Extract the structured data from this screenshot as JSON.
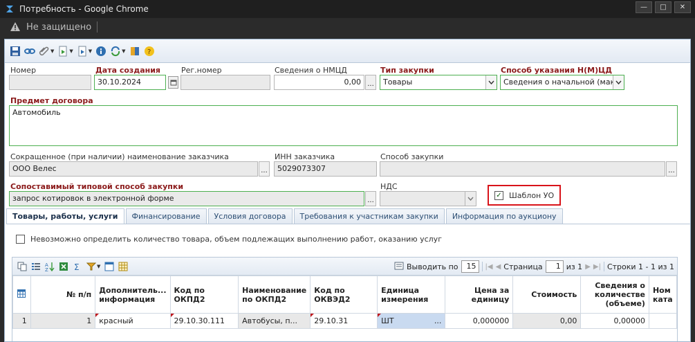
{
  "window": {
    "title": "Потребность - Google Chrome"
  },
  "address": {
    "security_text": "Не защищено"
  },
  "colors": {
    "required_label": "#8b1a1a",
    "highlight_border": "#d8131a",
    "valid_border": "#4caf50",
    "accent": "#2c4e73"
  },
  "form": {
    "nomer_label": "Номер",
    "nomer_value": "",
    "date_label": "Дата создания",
    "date_value": "30.10.2024",
    "regnomer_label": "Рег.номер",
    "regnomer_value": "",
    "nmcd_label": "Сведения о НМЦД",
    "nmcd_value": "0,00",
    "tip_label": "Тип закупки",
    "tip_value": "Товары",
    "sposob_nmcd_label": "Способ указания Н(М)ЦД",
    "sposob_nmcd_value": "Сведения о начальной (мак",
    "predmet_label": "Предмет договора",
    "predmet_value": "Автомобиль",
    "zakazchik_label": "Сокращенное (при наличии) наименование заказчика",
    "zakazchik_value": "ООО Велес",
    "inn_label": "ИНН заказчика",
    "inn_value": "5029073307",
    "sposob_zakupki_label": "Способ закупки",
    "sposob_zakupki_value": "",
    "sopost_label": "Сопоставимый типовой способ закупки",
    "sopost_value": "запрос котировок в электронной форме",
    "nds_label": "НДС",
    "nds_value": "",
    "shablon_label": "Шаблон УО",
    "shablon_checked": true
  },
  "tabs": [
    {
      "label": "Товары, работы, услуги",
      "active": true
    },
    {
      "label": "Финансирование",
      "active": false
    },
    {
      "label": "Условия договора",
      "active": false
    },
    {
      "label": "Требования к участникам закупки",
      "active": false
    },
    {
      "label": "Информация по аукциону",
      "active": false
    }
  ],
  "goods": {
    "impossible_label": "Невозможно определить количество товара, объем подлежащих выполнению работ, оказанию услуг",
    "impossible_checked": false,
    "pager": {
      "show_label": "Выводить по",
      "page_size": "15",
      "page_label": "Страница",
      "page": "1",
      "of_label": "из 1",
      "rows_label": "Строки 1 - 1 из 1"
    },
    "columns": [
      "№ п/п",
      "Дополнитель... информация",
      "Код по ОКПД2",
      "Наименование по ОКПД2",
      "Код по ОКВЭД2",
      "Единица измерения",
      "Цена за единицу",
      "Стоимость",
      "Сведения о количестве (объеме)",
      "Ном ката"
    ],
    "rows": [
      {
        "index": "1",
        "num": "1",
        "info": "красный",
        "okpd": "29.10.30.111",
        "okpd_name": "Автобусы, п...",
        "okved": "29.10.31",
        "unit": "ШТ",
        "unit_btn": "...",
        "price": "0,000000",
        "cost": "0,00",
        "qty": "0,00000",
        "nom": ""
      }
    ]
  }
}
